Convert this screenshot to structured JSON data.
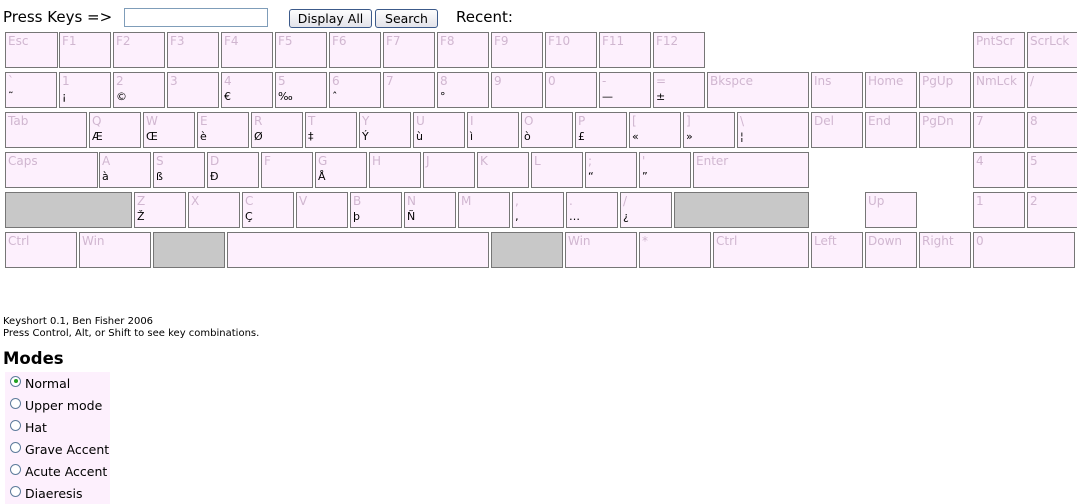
{
  "toolbar": {
    "press_label": "Press Keys =>",
    "input_value": "",
    "display_all_label": "Display All",
    "search_label": "Search",
    "recent_label": "Recent:"
  },
  "keyboard": {
    "rows": [
      [
        {
          "label": "Esc",
          "alt": ""
        },
        {
          "label": "F1",
          "alt": ""
        },
        {
          "label": "F2",
          "alt": ""
        },
        {
          "label": "F3",
          "alt": ""
        },
        {
          "label": "F4",
          "alt": ""
        },
        {
          "label": "F5",
          "alt": ""
        },
        {
          "label": "F6",
          "alt": ""
        },
        {
          "label": "F7",
          "alt": ""
        },
        {
          "label": "F8",
          "alt": ""
        },
        {
          "label": "F9",
          "alt": ""
        },
        {
          "label": "F10",
          "alt": ""
        },
        {
          "label": "F11",
          "alt": ""
        },
        {
          "label": "F12",
          "alt": ""
        },
        {
          "label": "PntScr",
          "alt": ""
        },
        {
          "label": "ScrLck",
          "alt": ""
        }
      ],
      [
        {
          "label": "`",
          "alt": "˜"
        },
        {
          "label": "1",
          "alt": "¡"
        },
        {
          "label": "2",
          "alt": "©"
        },
        {
          "label": "3",
          "alt": ""
        },
        {
          "label": "4",
          "alt": "€"
        },
        {
          "label": "5",
          "alt": "‰"
        },
        {
          "label": "6",
          "alt": "ˆ"
        },
        {
          "label": "7",
          "alt": ""
        },
        {
          "label": "8",
          "alt": "°"
        },
        {
          "label": "9",
          "alt": ""
        },
        {
          "label": "0",
          "alt": ""
        },
        {
          "label": "-",
          "alt": "—"
        },
        {
          "label": "=",
          "alt": "±"
        },
        {
          "label": "Bkspce",
          "alt": ""
        },
        {
          "label": "Ins",
          "alt": ""
        },
        {
          "label": "Home",
          "alt": ""
        },
        {
          "label": "PgUp",
          "alt": ""
        },
        {
          "label": "NmLck",
          "alt": ""
        },
        {
          "label": "/",
          "alt": ""
        }
      ],
      [
        {
          "label": "Tab",
          "alt": ""
        },
        {
          "label": "Q",
          "alt": "Æ"
        },
        {
          "label": "W",
          "alt": "Œ"
        },
        {
          "label": "E",
          "alt": "è"
        },
        {
          "label": "R",
          "alt": "Ø"
        },
        {
          "label": "T",
          "alt": "‡"
        },
        {
          "label": "Y",
          "alt": "Ý"
        },
        {
          "label": "U",
          "alt": "ù"
        },
        {
          "label": "I",
          "alt": "ì"
        },
        {
          "label": "O",
          "alt": "ò"
        },
        {
          "label": "P",
          "alt": "£"
        },
        {
          "label": "[",
          "alt": "«"
        },
        {
          "label": "]",
          "alt": "»"
        },
        {
          "label": "\\",
          "alt": "¦"
        },
        {
          "label": "Del",
          "alt": ""
        },
        {
          "label": "End",
          "alt": ""
        },
        {
          "label": "PgDn",
          "alt": ""
        },
        {
          "label": "7",
          "alt": ""
        },
        {
          "label": "8",
          "alt": ""
        }
      ],
      [
        {
          "label": "Caps",
          "alt": ""
        },
        {
          "label": "A",
          "alt": "à"
        },
        {
          "label": "S",
          "alt": "ß"
        },
        {
          "label": "D",
          "alt": "Ð"
        },
        {
          "label": "F",
          "alt": ""
        },
        {
          "label": "G",
          "alt": "Å"
        },
        {
          "label": "H",
          "alt": ""
        },
        {
          "label": "J",
          "alt": ""
        },
        {
          "label": "K",
          "alt": ""
        },
        {
          "label": "L",
          "alt": ""
        },
        {
          "label": ";",
          "alt": "“"
        },
        {
          "label": "'",
          "alt": "”"
        },
        {
          "label": "Enter",
          "alt": ""
        },
        {
          "label": "4",
          "alt": ""
        },
        {
          "label": "5",
          "alt": ""
        }
      ],
      [
        {
          "label": "",
          "alt": ""
        },
        {
          "label": "Z",
          "alt": "Ž"
        },
        {
          "label": "X",
          "alt": ""
        },
        {
          "label": "C",
          "alt": "Ç"
        },
        {
          "label": "V",
          "alt": ""
        },
        {
          "label": "B",
          "alt": "þ"
        },
        {
          "label": "N",
          "alt": "Ñ"
        },
        {
          "label": "M",
          "alt": ""
        },
        {
          "label": ",",
          "alt": "‚"
        },
        {
          "label": ".",
          "alt": "…"
        },
        {
          "label": "/",
          "alt": "¿"
        },
        {
          "label": "",
          "alt": ""
        },
        {
          "label": "Up",
          "alt": ""
        },
        {
          "label": "1",
          "alt": ""
        },
        {
          "label": "2",
          "alt": ""
        }
      ],
      [
        {
          "label": "Ctrl",
          "alt": ""
        },
        {
          "label": "Win",
          "alt": ""
        },
        {
          "label": "",
          "alt": ""
        },
        {
          "label": "",
          "alt": ""
        },
        {
          "label": "",
          "alt": ""
        },
        {
          "label": "Win",
          "alt": ""
        },
        {
          "label": "*",
          "alt": ""
        },
        {
          "label": "Ctrl",
          "alt": ""
        },
        {
          "label": "Left",
          "alt": ""
        },
        {
          "label": "Down",
          "alt": ""
        },
        {
          "label": "Right",
          "alt": ""
        },
        {
          "label": "0",
          "alt": ""
        }
      ]
    ]
  },
  "footer": {
    "line1": "Keyshort 0.1, Ben Fisher 2006",
    "line2": "Press Control, Alt, or Shift to see key combinations."
  },
  "modes": {
    "title": "Modes",
    "items": [
      {
        "label": "Normal",
        "selected": true
      },
      {
        "label": "Upper mode",
        "selected": false
      },
      {
        "label": "Hat",
        "selected": false
      },
      {
        "label": "Grave Accent",
        "selected": false
      },
      {
        "label": "Acute Accent",
        "selected": false
      },
      {
        "label": "Diaeresis",
        "selected": false
      }
    ]
  }
}
